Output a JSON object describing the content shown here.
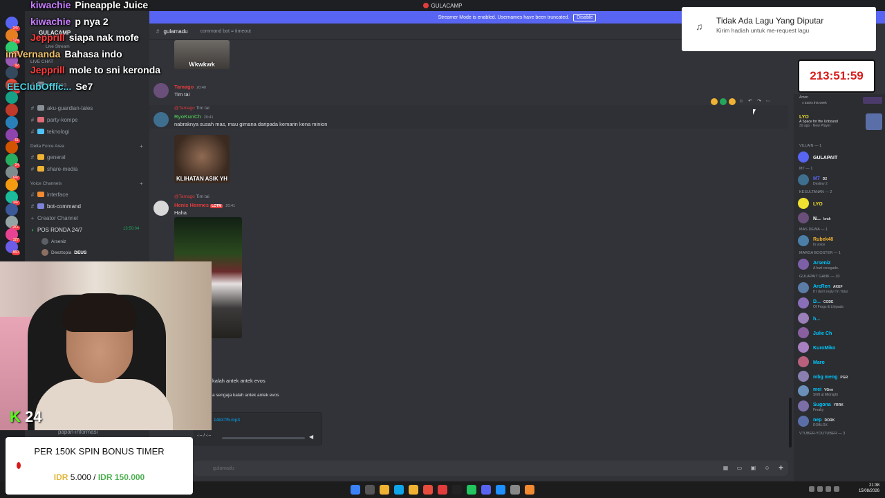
{
  "titlebar": {
    "title": "GULACAMP"
  },
  "banner": {
    "text": "Streamer Mode is enabled. Usernames have been truncated.",
    "button": "Disable"
  },
  "server_badges": [
    "347",
    "174",
    "129",
    "92",
    "",
    "13",
    "",
    "",
    "",
    "61",
    "",
    "24",
    "647",
    "",
    "347",
    "",
    "2K+",
    "327",
    "860"
  ],
  "sidebar": {
    "server_name": "GULACAMP",
    "rows": [
      {
        "name": "weaboo"
      },
      {
        "name": "aku-guardian-tales"
      },
      {
        "name": "party-kompe"
      },
      {
        "name": "teknologi"
      }
    ],
    "category_delta": "Delta Force Area",
    "delta_rows": [
      {
        "name": "general"
      },
      {
        "name": "share-media"
      }
    ],
    "category_voice": "Voice Channels",
    "voice_rows": [
      {
        "name": "interface"
      },
      {
        "name": "bot-command"
      },
      {
        "name": "Creator Channel"
      },
      {
        "name": "POS RONDA 24/7"
      }
    ],
    "voice_time": "13:50:04",
    "voice_users": [
      {
        "name": "Arseniz"
      },
      {
        "name": "Deeztopia",
        "tag": "DEUS"
      }
    ],
    "live_stream": "Live Stream",
    "live_chat": "LIVE CHAT",
    "bottom_channel": "papan-informasi"
  },
  "chat": {
    "channel": "gulamadu",
    "topic": "command bot = timeout",
    "meme1_caption": "Wkwkwk",
    "msg1": {
      "name": "Tamago",
      "time": "20:40",
      "text": "Tim tai"
    },
    "reply1": {
      "name": "@Tamago",
      "text": "Tim tai"
    },
    "msg2": {
      "name": "RyoKunCh",
      "time": "20:41",
      "text": "nabraknya susah mas, mau gimana daripada kemarin kena minion"
    },
    "meme2_caption": "KLIHATAN ASIK YH",
    "reply2": {
      "name": "@Tamago",
      "text": "Tim tai"
    },
    "msg3": {
      "name": "Henis Hermes",
      "tag": "LOTM",
      "time": "20:41",
      "text": "Haha"
    },
    "line4": "kalah antek antek evos",
    "line5": "a sengaja kalah antek antek evos",
    "attachment": {
      "file": "14b37f5.mp3",
      "time": "-:-- / -:--"
    },
    "composer_placeholder": "gulamadu"
  },
  "members": {
    "top_name": "Amon",
    "top_status": "4 tracks this week",
    "lyo_top": {
      "name": "LYO",
      "status": "A Space for the Unbound",
      "sub": "3d ago · New Player"
    },
    "groups": [
      {
        "label": "VILLAIN — 1",
        "items": [
          {
            "name": "GULAPAIT",
            "color": "#ffffff"
          }
        ]
      },
      {
        "label": "M7 — 1",
        "items": [
          {
            "name": "M7",
            "tag": "D2",
            "status": "Destiny 2",
            "color": "#5865f2"
          }
        ]
      },
      {
        "label": "KESULTANAN — 2",
        "items": [
          {
            "name": "LYO",
            "color": "#f0e130"
          },
          {
            "name": "N...",
            "tag": "brak",
            "color": "#ffffff"
          }
        ]
      },
      {
        "label": "MAS DEWA — 1",
        "items": [
          {
            "name": "Rubek48",
            "status": "In voice",
            "color": "#f0b232"
          }
        ]
      },
      {
        "label": "MARGA BOOSTER — 1",
        "items": [
          {
            "name": "Arseniz",
            "status": "A fowl renegade.",
            "color": "#00c8ff"
          }
        ]
      },
      {
        "label": "GULAPAIT GANK — 10",
        "items": [
          {
            "name": "ArcRen",
            "tag": "AKEF",
            "status": "If I don't reply I'm Tidur",
            "color": "#00c8ff"
          },
          {
            "name": "D...",
            "tag": "CODE",
            "status": "Of Frogs & Lilypads",
            "color": "#00c8ff"
          },
          {
            "name": "h...",
            "color": "#00c8ff"
          },
          {
            "name": "Julie Ch",
            "color": "#00c8ff"
          },
          {
            "name": "KuroMiko",
            "color": "#00c8ff"
          },
          {
            "name": "Maro",
            "color": "#00c8ff"
          },
          {
            "name": "mbg meng",
            "tag": "PGR",
            "color": "#00c8ff"
          },
          {
            "name": "mei",
            "tag": "VGen",
            "status": "Shift at Midnight",
            "color": "#00c8ff"
          },
          {
            "name": "Sugona",
            "tag": "YRRK",
            "status": "Freaky",
            "color": "#00c8ff"
          },
          {
            "name": "nep",
            "tag": "DORK",
            "status": "ROBLOX",
            "color": "#00c8ff"
          }
        ]
      },
      {
        "label": "VTUBER-YOUTUBER — 3",
        "items": []
      }
    ]
  },
  "overlay_chat": [
    {
      "name": "kiwachie",
      "text": "Pineapple Juice",
      "color": "#c77dff"
    },
    {
      "name": "kiwachie",
      "text": "p nya 2",
      "color": "#c77dff"
    },
    {
      "name": "Jepprill",
      "text": "siapa nak mofe",
      "color": "#ff3a3a"
    },
    {
      "name": "imVernanda",
      "text": "Bahasa indo",
      "color": "#f0c36a"
    },
    {
      "name": "Jepprill",
      "text": "mole to sni keronda",
      "color": "#ff3a3a"
    },
    {
      "name": "EEClubOffic...",
      "text": "Se7",
      "color": "#4dd0e1"
    }
  ],
  "kick": {
    "logo": "K",
    "count": "24"
  },
  "bonus": {
    "title": "PER 150K SPIN BONUS TIMER",
    "currency": "IDR",
    "current": "5.000",
    "sep": "/",
    "max": "150.000"
  },
  "song": {
    "title": "Tidak Ada Lagu Yang Diputar",
    "subtitle": "Kirim hadiah untuk me-request lagu"
  },
  "timer": {
    "value": "213:51:59"
  },
  "tray": {
    "time": "21:38",
    "date": "15/08/2026"
  },
  "colors": {
    "accent": "#5865f2",
    "bg": "#313338",
    "sidebar": "#2b2d31",
    "servers": "#1e1f22"
  }
}
